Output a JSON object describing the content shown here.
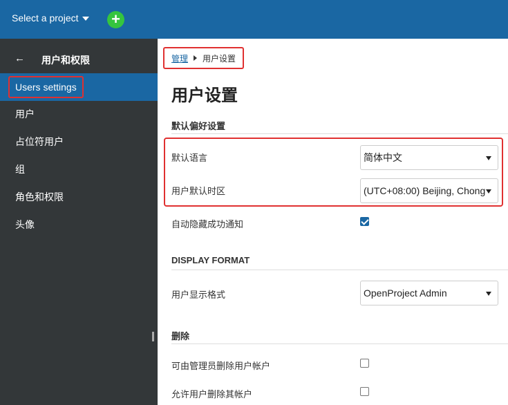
{
  "header": {
    "project_select_label": "Select a project",
    "add_button_label": "+"
  },
  "sidebar": {
    "back_label": "←",
    "title": "用户和权限",
    "items": [
      {
        "label": "Users settings",
        "active": true
      },
      {
        "label": "用户"
      },
      {
        "label": "占位符用户"
      },
      {
        "label": "组"
      },
      {
        "label": "角色和权限"
      },
      {
        "label": "头像"
      }
    ]
  },
  "breadcrumb": {
    "parent": "管理",
    "current": "用户设置"
  },
  "main": {
    "title": "用户设置",
    "sections": {
      "preferences": {
        "title": "默认偏好设置",
        "language_label": "默认语言",
        "language_value": "简体中文",
        "timezone_label": "用户默认时区",
        "timezone_value": "(UTC+08:00) Beijing, Chong",
        "auto_hide_label": "自动隐藏成功通知",
        "auto_hide_checked": true
      },
      "display_format": {
        "title": "DISPLAY FORMAT",
        "format_label": "用户显示格式",
        "format_value": "OpenProject Admin"
      },
      "delete": {
        "title": "删除",
        "admin_delete_label": "可由管理员删除用户帐户",
        "admin_delete_checked": false,
        "self_delete_label": "允许用户删除其帐户",
        "self_delete_checked": false
      }
    }
  },
  "colors": {
    "header_bg": "#1a67a3",
    "sidebar_bg": "#333739",
    "active_item_bg": "#1a67a3",
    "add_button": "#35c53f",
    "highlight_border": "#e03030"
  }
}
